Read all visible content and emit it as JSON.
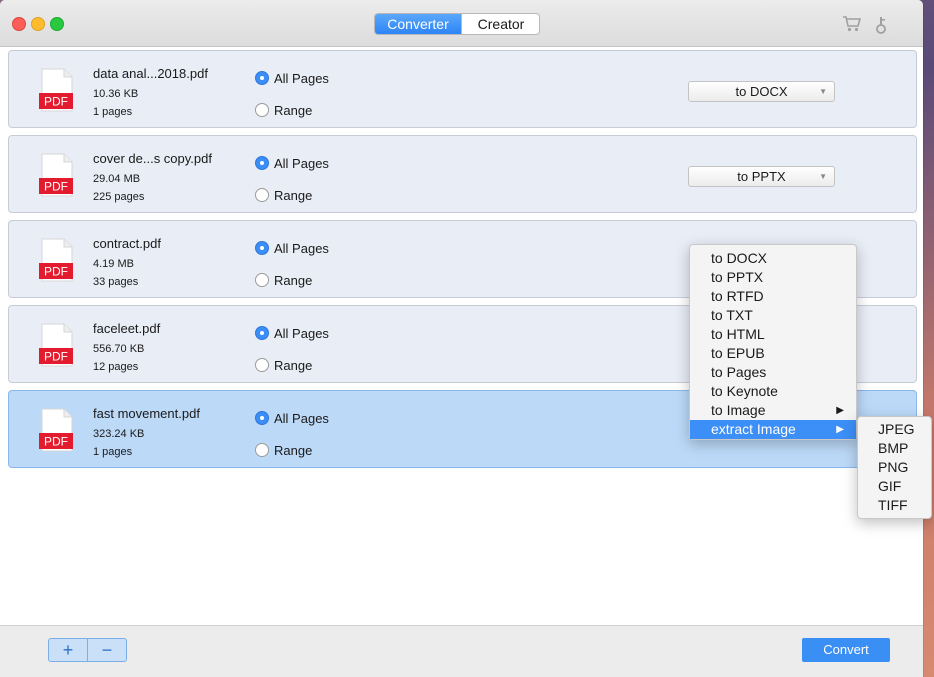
{
  "toolbar": {
    "tabs": [
      {
        "label": "Converter",
        "active": true
      },
      {
        "label": "Creator",
        "active": false
      }
    ],
    "icons": [
      "cart-icon",
      "key-icon"
    ]
  },
  "colors": {
    "accent": "#3b8ef7",
    "selected_row": "#bcd9f8",
    "row": "#e8edf6",
    "pdf_badge": "#e21b2e"
  },
  "pdf_badge_label": "PDF",
  "radio_labels": {
    "all": "All Pages",
    "range": "Range"
  },
  "files": [
    {
      "name": "data anal...2018.pdf",
      "size": "10.36 KB",
      "pages": "1 pages",
      "all_pages": true,
      "format": "to DOCX"
    },
    {
      "name": "cover de...s copy.pdf",
      "size": "29.04 MB",
      "pages": "225 pages",
      "all_pages": true,
      "format": "to PPTX"
    },
    {
      "name": "contract.pdf",
      "size": "4.19 MB",
      "pages": "33 pages",
      "all_pages": true,
      "format": ""
    },
    {
      "name": "faceleet.pdf",
      "size": "556.70 KB",
      "pages": "12 pages",
      "all_pages": true,
      "format": ""
    },
    {
      "name": "fast movement.pdf",
      "size": "323.24 KB",
      "pages": "1 pages",
      "all_pages": true,
      "format": "",
      "selected": true
    }
  ],
  "format_menu": {
    "items": [
      "to DOCX",
      "to PPTX",
      "to RTFD",
      "to TXT",
      "to HTML",
      "to EPUB",
      "to Pages",
      "to Keynote",
      "to Image",
      "extract Image"
    ],
    "highlighted": "extract Image",
    "submenu_items": [
      "JPEG",
      "BMP",
      "PNG",
      "GIF",
      "TIFF"
    ]
  },
  "bottom": {
    "add": "+",
    "remove": "−",
    "convert": "Convert"
  }
}
